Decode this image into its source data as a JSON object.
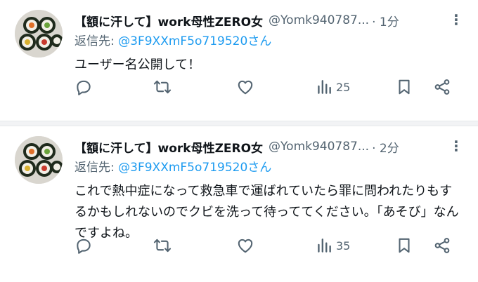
{
  "tweets": [
    {
      "author_name": "【額に汗して】work母性ZERO女",
      "handle": "@Yomk940787...",
      "time": "· 1分",
      "reply_prefix": "返信先: ",
      "reply_to": "@3F9XXmF5o719520さん",
      "text": "ユーザー名公開して！",
      "views": "25"
    },
    {
      "author_name": "【額に汗して】work母性ZERO女",
      "handle": "@Yomk940787...",
      "time": "· 2分",
      "reply_prefix": "返信先: ",
      "reply_to": "@3F9XXmF5o719520さん",
      "text": "これで熱中症になって救急車で運ばれていたら罪に問われたりもするかもしれないのでクビを洗って待っててください。「あそび」なんですよね。",
      "views": "35"
    }
  ],
  "more_label": "⋮",
  "colors": {
    "accent": "#1d9bf0",
    "secondary": "#536471",
    "text": "#0f1419"
  },
  "icons": [
    "reply-icon",
    "retweet-icon",
    "like-icon",
    "views-icon",
    "bookmark-icon",
    "share-icon",
    "more-icon",
    "avatar-image"
  ]
}
